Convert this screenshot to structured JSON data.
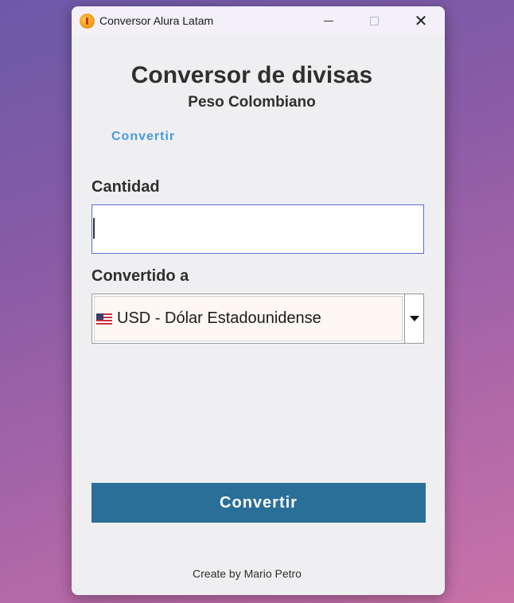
{
  "window": {
    "title": "Conversor Alura Latam",
    "minimize": "—",
    "maximize": "",
    "close": "✕"
  },
  "main": {
    "heading": "Conversor de divisas",
    "subheading": "Peso Colombiano",
    "link_label": "Convertir",
    "amount_label": "Cantidad",
    "amount_value": "",
    "amount_placeholder": "",
    "target_label": "Convertido a",
    "target_selected": "USD - Dólar Estadounidense",
    "convert_button": "Convertir",
    "footer": "Create by Mario Petro"
  },
  "colors": {
    "button_bg": "#2a6f97",
    "link": "#4a9ae0",
    "input_border": "#5a6cd8"
  },
  "icons": {
    "app": "app-orange-circle-icon",
    "flag": "us-flag-icon",
    "dropdown": "triangle-down-icon"
  }
}
